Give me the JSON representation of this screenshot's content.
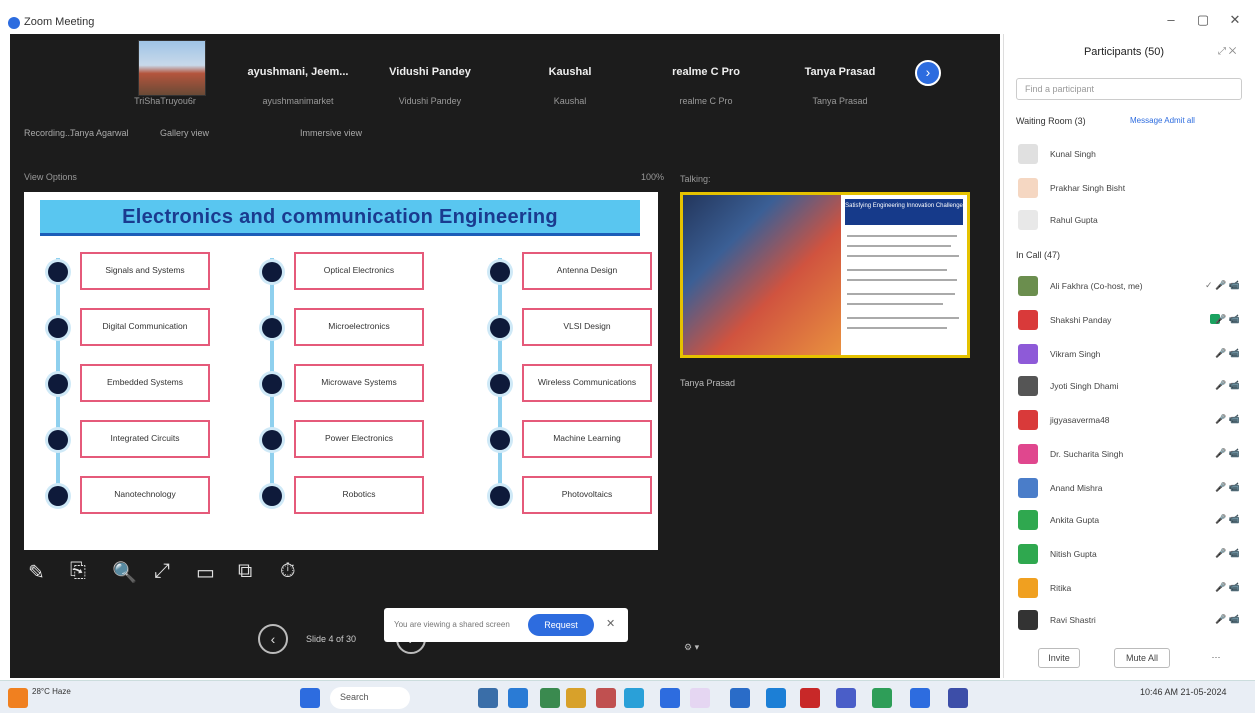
{
  "window": {
    "title": "Zoom Meeting",
    "controls": [
      "–",
      "▢",
      "✕"
    ]
  },
  "participants_strip": [
    {
      "name": "",
      "sub": "TriShaTruyou6r"
    },
    {
      "name": "ayushmani, Jeem...",
      "sub": "ayushmanimarket"
    },
    {
      "name": "Vidushi Pandey",
      "sub": "Vidushi Pandey"
    },
    {
      "name": "Kaushal",
      "sub": "Kaushal"
    },
    {
      "name": "realme C Pro",
      "sub": "realme C Pro"
    },
    {
      "name": "Tanya Prasad",
      "sub": "Tanya Prasad"
    }
  ],
  "view_bar": {
    "items": [
      "Recording...",
      "Tanya Agarwal",
      "Gallery view",
      "Immersive view"
    ]
  },
  "share_header": {
    "left": "View Options",
    "right": "100%"
  },
  "slide": {
    "title": "Electronics and communication Engineering",
    "columns": [
      [
        "Signals and Systems",
        "Digital Communication",
        "Embedded Systems",
        "Integrated Circuits",
        "Nanotechnology"
      ],
      [
        "Optical Electronics",
        "Microelectronics",
        "Microwave Systems",
        "Power Electronics",
        "Robotics"
      ],
      [
        "Antenna Design",
        "VLSI Design",
        "Wireless Communications",
        "Machine Learning",
        "Photovoltaics"
      ]
    ]
  },
  "annotation_tools": [
    "✎",
    "⎘",
    "🔍",
    "⤢",
    "▭",
    "⧉",
    "⏱"
  ],
  "slide_nav": {
    "prev": "‹",
    "next": "›",
    "label": "Slide 4 of 30"
  },
  "notification": {
    "text": "You are viewing a shared screen",
    "button": "Request",
    "close": "✕"
  },
  "speaker": {
    "label": "Talking:",
    "name": "Tanya Prasad",
    "card_title": "Satisfying Engineering Innovation Challenge"
  },
  "bottom_controls": "⚙ ▾",
  "panel": {
    "title": "Participants (50)",
    "search_placeholder": "Find a participant",
    "breakout_label": "Waiting Room (3)",
    "breakout_actions": "Message  Admit all",
    "waiting": [
      {
        "name": "Kunal Singh",
        "color": "#e0e0e0"
      },
      {
        "name": "Prakhar Singh Bisht",
        "color": "#f5d7c2"
      },
      {
        "name": "Rahul Gupta",
        "color": "#e8e8e8"
      }
    ],
    "in_call_label": "In Call (47)",
    "members": [
      {
        "name": "Ali Fakhra (Co-host, me)",
        "color": "#6b8e4e",
        "icons": "✓ 🎤 📹",
        "cam": false
      },
      {
        "name": "Shakshi Panday",
        "color": "#d93a3a",
        "icons": "🎤 📹",
        "cam": true
      },
      {
        "name": "Vikram Singh",
        "color": "#8e5ad8",
        "icons": "🎤 📹",
        "cam": false
      },
      {
        "name": "Jyoti Singh Dhami",
        "color": "#555",
        "icons": "🎤 📹",
        "cam": false
      },
      {
        "name": "jigyasaverma48",
        "color": "#d93a3a",
        "icons": "🎤 📹",
        "cam": false
      },
      {
        "name": "Dr. Sucharita Singh",
        "color": "#e0478e",
        "icons": "🎤 📹",
        "cam": false
      },
      {
        "name": "Anand Mishra",
        "color": "#4a7dc9",
        "icons": "🎤 📹",
        "cam": false
      },
      {
        "name": "Ankita Gupta",
        "color": "#2fa84f",
        "icons": "🎤 📹",
        "cam": false
      },
      {
        "name": "Nitish Gupta",
        "color": "#2fa84f",
        "icons": "🎤 📹",
        "cam": false
      },
      {
        "name": "Ritika",
        "color": "#f0a020",
        "icons": "🎤 📹",
        "cam": false
      },
      {
        "name": "Ravi Shastri",
        "color": "#333",
        "icons": "🎤 📹",
        "cam": false
      }
    ],
    "buttons": [
      "Invite",
      "Mute All",
      "···"
    ]
  },
  "taskbar": {
    "weather": "28°C Haze",
    "search": "Search",
    "clock": "10:46 AM\n21-05-2024"
  }
}
